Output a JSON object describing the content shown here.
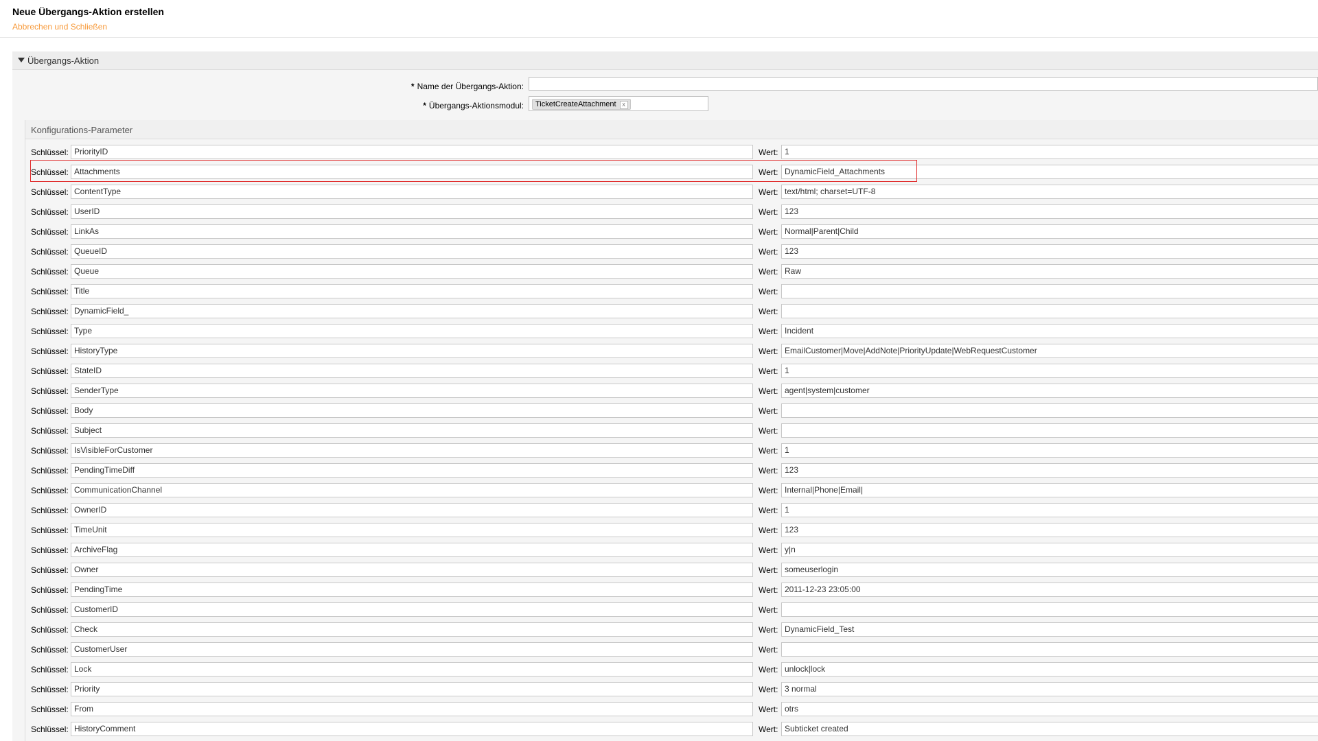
{
  "header": {
    "title": "Neue Übergangs-Aktion erstellen",
    "cancel_link": "Abbrechen und Schließen"
  },
  "section": {
    "title": "Übergangs-Aktion",
    "name_label": "Name der Übergangs-Aktion:",
    "module_label": "Übergangs-Aktionsmodul:",
    "required_marker": "*",
    "name_value": "",
    "module_value": "TicketCreateAttachment",
    "module_remove": "x"
  },
  "config": {
    "title": "Konfigurations-Parameter",
    "key_label": "Schlüssel:",
    "value_label": "Wert:",
    "highlight_color": "#e02a2a",
    "rows": [
      {
        "key": "PriorityID",
        "value": "1"
      },
      {
        "key": "Attachments",
        "value": "DynamicField_Attachments"
      },
      {
        "key": "ContentType",
        "value": "text/html; charset=UTF-8"
      },
      {
        "key": "UserID",
        "value": "123"
      },
      {
        "key": "LinkAs",
        "value": "Normal|Parent|Child"
      },
      {
        "key": "QueueID",
        "value": "123"
      },
      {
        "key": "Queue",
        "value": "Raw"
      },
      {
        "key": "Title",
        "value": ""
      },
      {
        "key": "DynamicField_",
        "value": ""
      },
      {
        "key": "Type",
        "value": "Incident"
      },
      {
        "key": "HistoryType",
        "value": "EmailCustomer|Move|AddNote|PriorityUpdate|WebRequestCustomer"
      },
      {
        "key": "StateID",
        "value": "1"
      },
      {
        "key": "SenderType",
        "value": "agent|system|customer"
      },
      {
        "key": "Body",
        "value": ""
      },
      {
        "key": "Subject",
        "value": ""
      },
      {
        "key": "IsVisibleForCustomer",
        "value": "1"
      },
      {
        "key": "PendingTimeDiff",
        "value": "123"
      },
      {
        "key": "CommunicationChannel",
        "value": "Internal|Phone|Email|"
      },
      {
        "key": "OwnerID",
        "value": "1"
      },
      {
        "key": "TimeUnit",
        "value": "123"
      },
      {
        "key": "ArchiveFlag",
        "value": "y|n"
      },
      {
        "key": "Owner",
        "value": "someuserlogin"
      },
      {
        "key": "PendingTime",
        "value": "2011-12-23 23:05:00"
      },
      {
        "key": "CustomerID",
        "value": ""
      },
      {
        "key": "Check",
        "value": "DynamicField_Test"
      },
      {
        "key": "CustomerUser",
        "value": ""
      },
      {
        "key": "Lock",
        "value": "unlock|lock"
      },
      {
        "key": "Priority",
        "value": "3 normal"
      },
      {
        "key": "From",
        "value": "otrs"
      },
      {
        "key": "HistoryComment",
        "value": "Subticket created"
      }
    ]
  }
}
